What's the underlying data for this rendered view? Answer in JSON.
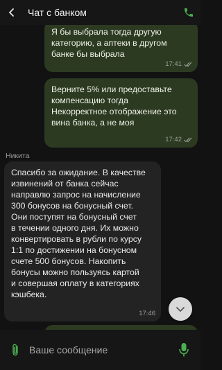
{
  "header": {
    "title": "Чат с банком",
    "back_icon": "chevron-left-icon",
    "call_icon": "phone-icon"
  },
  "messages": [
    {
      "direction": "out",
      "text": "Я бы выбрала тогда другую\nкатегорию, а аптеки в другом\nбанке бы выбрала",
      "time": "17:41",
      "status": "read"
    },
    {
      "direction": "out",
      "text": "Верните 5% или предоставьте\nкомпенсацию тогда\nНекорректное отображение это\nвина банка, а не моя",
      "time": "17:42",
      "status": "read"
    },
    {
      "direction": "in",
      "sender": "Никита",
      "text": "Спасибо за ожидание. В качестве\nизвинений от банка сейчас\nнаправлю запрос на начисление\n300 бонусов на бонусный счет.\nОни поступят на бонусный счет\nв течении одного дня. Их можно\nконвертировать в рубли по курсу\n1:1 по достижении на бонусном\nсчете 500 бонусов. Накопить\nбонусы можно пользуясь картой\nи совершая оплату в категориях\nкэшбека.",
      "time": "17:46"
    }
  ],
  "composer": {
    "placeholder": "Ваше сообщение",
    "attach_icon": "paperclip-icon",
    "mic_icon": "microphone-icon"
  },
  "colors": {
    "accent": "#4caf50",
    "outgoing_bubble": "#2c3a22",
    "incoming_bubble": "#232323",
    "background": "#121212"
  }
}
